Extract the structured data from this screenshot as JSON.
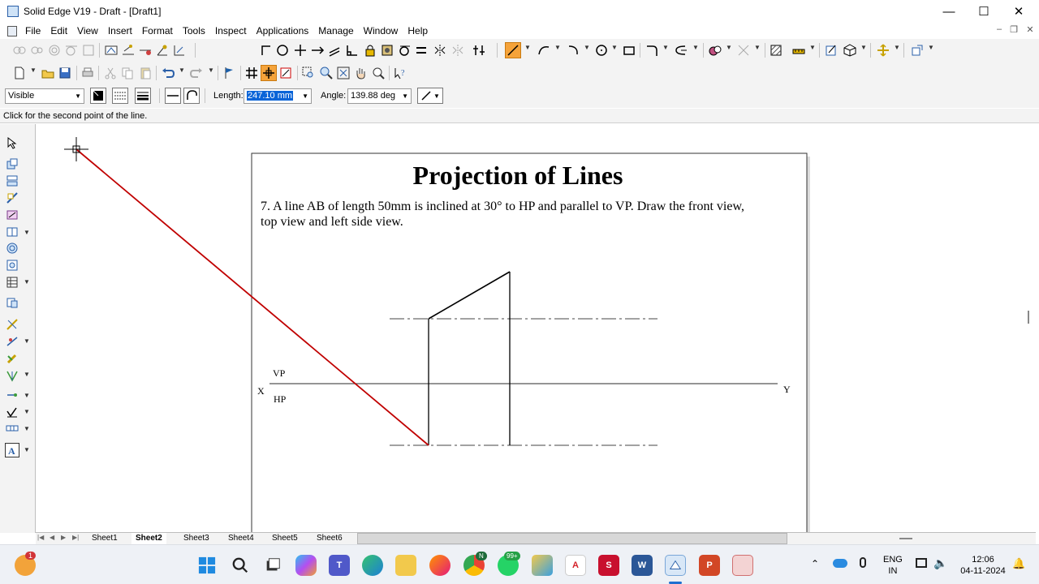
{
  "window": {
    "title": "Solid Edge V19 - Draft - [Draft1]",
    "minimize": "—",
    "maximize": "☐",
    "close": "✕"
  },
  "menu": {
    "items": [
      "File",
      "Edit",
      "View",
      "Insert",
      "Format",
      "Tools",
      "Inspect",
      "Applications",
      "Manage",
      "Window",
      "Help"
    ],
    "mdi_min": "–",
    "mdi_restore": "❐",
    "mdi_close": "✕"
  },
  "ribbon": {
    "line_style_value": "Visible",
    "length_label": "Length:",
    "length_value": "247.10 mm",
    "angle_label": "Angle:",
    "angle_value": "139.88 deg"
  },
  "status": {
    "prompt": "Click for the second point of the line."
  },
  "drawing": {
    "title": "Projection of Lines",
    "problem_line1": "7. A line AB of length 50mm is inclined at 30° to HP and parallel to VP. Draw the front view,",
    "problem_line2": "top view and left side view.",
    "label_vp": "VP",
    "label_hp": "HP",
    "label_x": "X",
    "label_y": "Y"
  },
  "sheets": {
    "tabs": [
      "Sheet1",
      "Sheet2",
      "Sheet3",
      "Sheet4",
      "Sheet5",
      "Sheet6"
    ],
    "active": "Sheet2"
  },
  "taskbar": {
    "badge_top_left": "1",
    "badge_whatsapp": "99+",
    "badge_chrome": "N",
    "lang_line1": "ENG",
    "lang_line2": "IN",
    "time": "12:06",
    "date": "04-11-2024"
  },
  "colors": {
    "accent_red": "#c00000",
    "highlight_orange": "#f5a33a",
    "selection_blue": "#0a64d8"
  }
}
